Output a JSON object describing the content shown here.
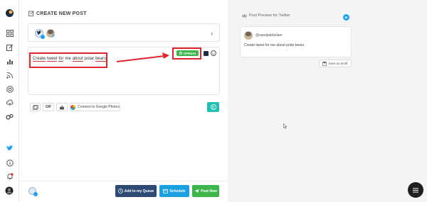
{
  "header": {
    "title": "CREATE NEW POST"
  },
  "editor": {
    "text_words": [
      "Create",
      "tweet",
      "for",
      "me",
      "about",
      "polar",
      "bears"
    ]
  },
  "openai": {
    "label": "OPENAI"
  },
  "toolbar": {
    "gif_label": "GIF",
    "google_photos_label": "Connect to Google Photos"
  },
  "actions": {
    "queue_label": "Add to my Queue",
    "schedule_label": "Schedule",
    "post_label": "Post Now"
  },
  "preview": {
    "title": "Post Preview for Twitter",
    "username": "@sandjakdarlaer",
    "text": "Create tweet for me about polar bears",
    "draft_label": "Save as Draft"
  },
  "colors": {
    "twitter": "#1da1f2",
    "openai_green": "#3cb54a",
    "queue_navy": "#2c4a73",
    "schedule_blue": "#1a9fe0",
    "post_green": "#3cb54a",
    "teal": "#20c1b5",
    "highlight_red": "#e0252b"
  },
  "icons": {
    "sidebar": [
      "logo-icon",
      "grid-icon",
      "edit-icon",
      "chart-icon",
      "rss-icon",
      "target-icon",
      "cloud-icon",
      "gears-icon",
      "twitter-icon",
      "info-icon",
      "bell-icon",
      "user-avatar"
    ]
  }
}
